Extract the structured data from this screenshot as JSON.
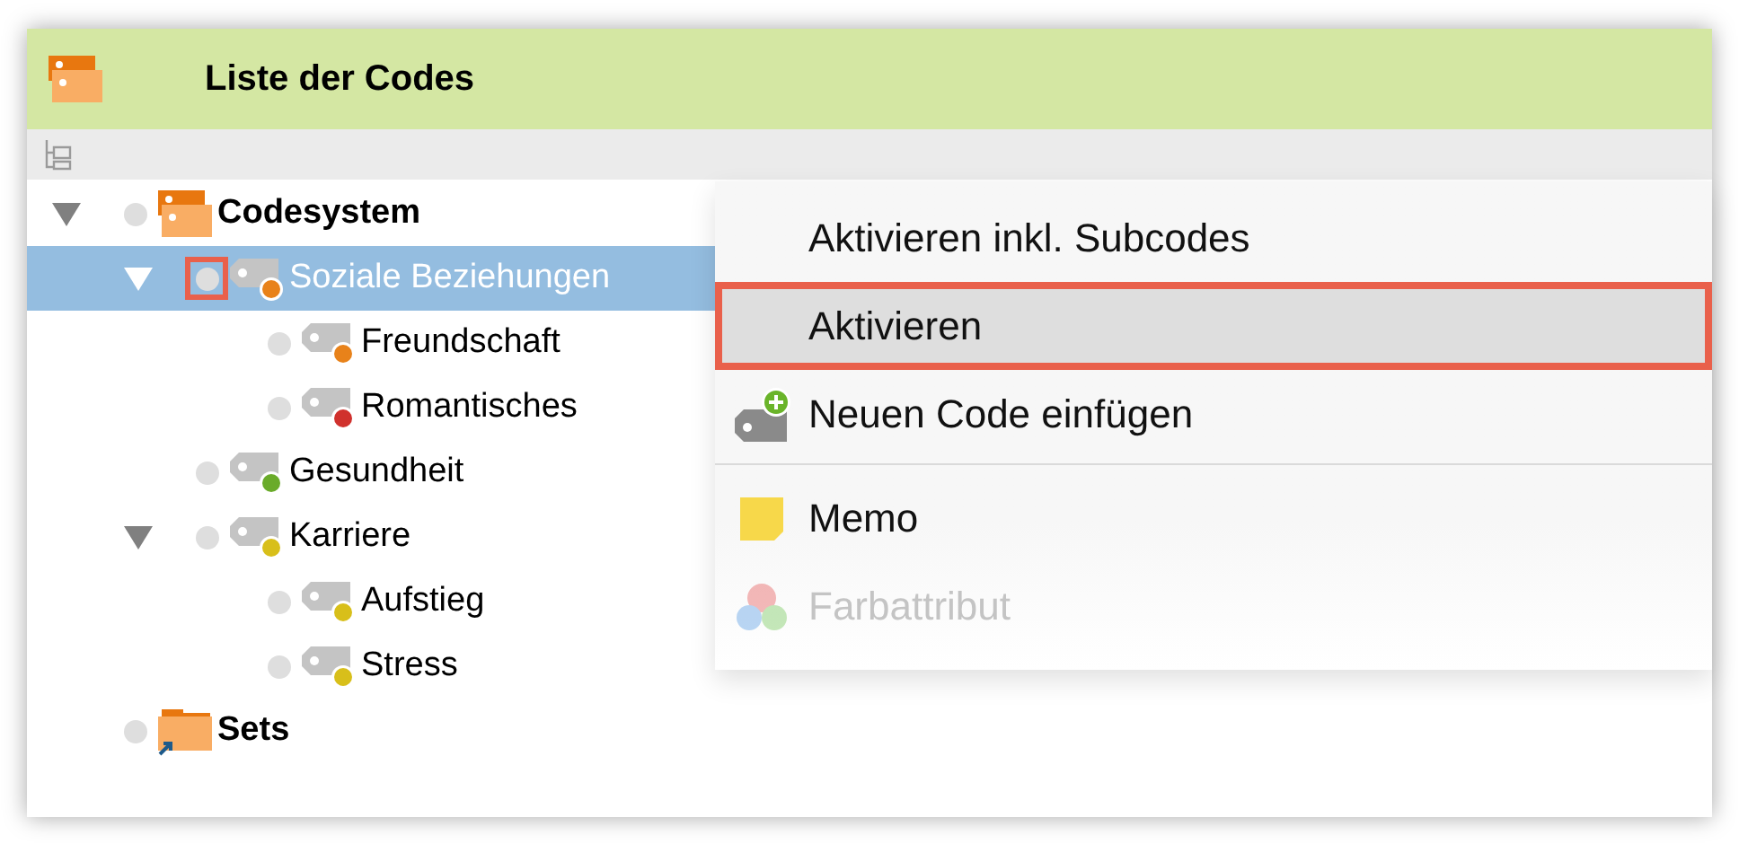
{
  "window": {
    "title": "Liste der Codes"
  },
  "tree": [
    {
      "label": "Codesystem",
      "kind": "root",
      "expanded": true,
      "selected": false,
      "outlined": false,
      "children": [
        {
          "label": "Soziale Beziehungen",
          "kind": "code",
          "color": "#e8821a",
          "expanded": true,
          "selected": true,
          "outlined": true,
          "children": [
            {
              "label": "Freundschaft",
              "kind": "code",
              "color": "#e8821a",
              "selected": false,
              "outlined": false
            },
            {
              "label": "Romantisches",
              "kind": "code",
              "color": "#d0312d",
              "selected": false,
              "outlined": false
            }
          ]
        },
        {
          "label": "Gesundheit",
          "kind": "code",
          "color": "#6aab2a",
          "selected": false,
          "outlined": false
        },
        {
          "label": "Karriere",
          "kind": "code",
          "color": "#d8bf1a",
          "expanded": true,
          "selected": false,
          "outlined": false,
          "children": [
            {
              "label": "Aufstieg",
              "kind": "code",
              "color": "#d8bf1a",
              "selected": false,
              "outlined": false
            },
            {
              "label": "Stress",
              "kind": "code",
              "color": "#d8bf1a",
              "selected": false,
              "outlined": false
            }
          ]
        }
      ]
    },
    {
      "label": "Sets",
      "kind": "set",
      "selected": false,
      "outlined": false
    }
  ],
  "context_menu": [
    {
      "label": "Aktivieren inkl. Subcodes",
      "kind": "text",
      "selected": false,
      "outlined": false,
      "faded": false,
      "divider_before": false
    },
    {
      "label": "Aktivieren",
      "kind": "text",
      "selected": true,
      "outlined": true,
      "faded": false,
      "divider_before": false
    },
    {
      "label": "Neuen Code einfügen",
      "kind": "add-code",
      "selected": false,
      "outlined": false,
      "faded": false,
      "divider_before": false
    },
    {
      "label": "Memo",
      "kind": "memo",
      "selected": false,
      "outlined": false,
      "faded": false,
      "divider_before": true
    },
    {
      "label": "Farbattribut",
      "kind": "color-attribute",
      "selected": false,
      "outlined": false,
      "faded": true,
      "divider_before": false
    }
  ]
}
